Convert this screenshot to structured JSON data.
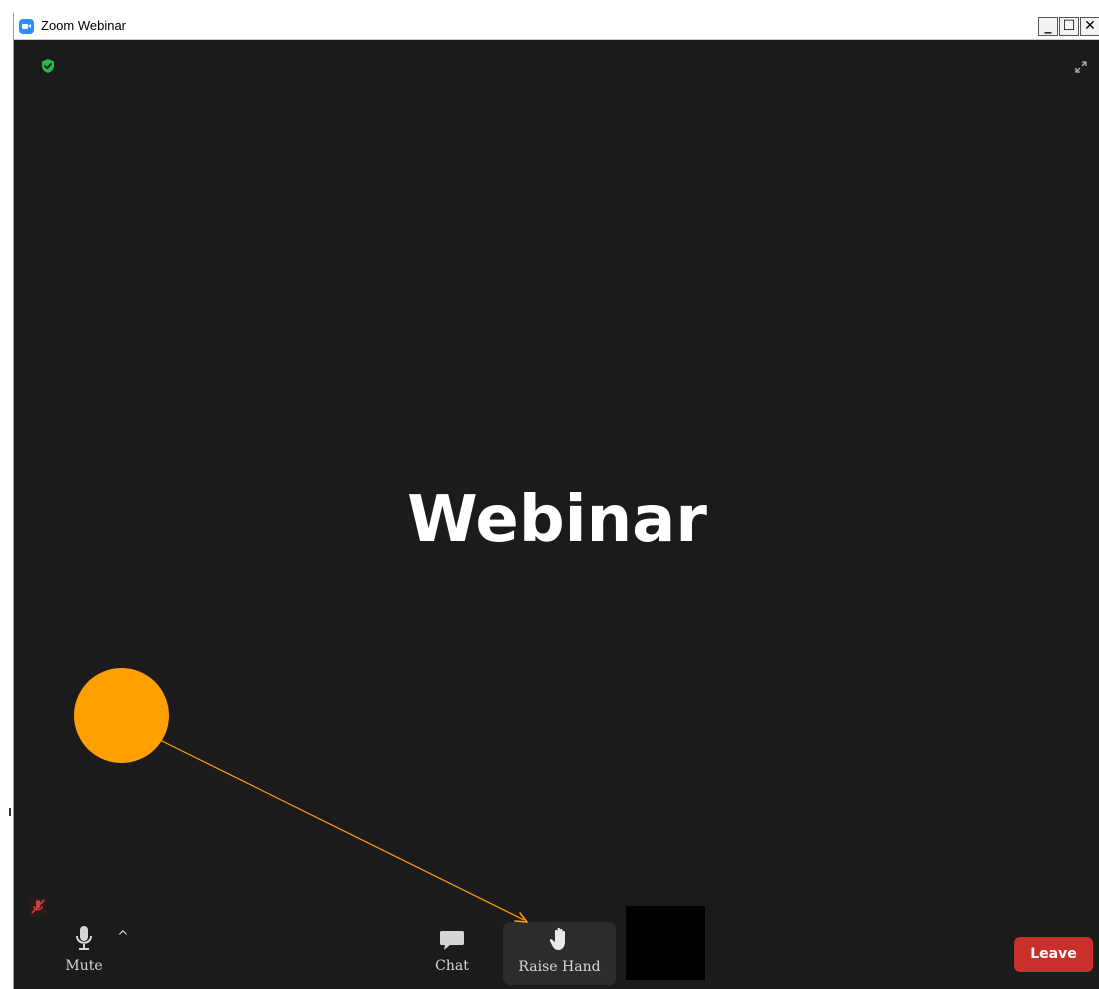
{
  "window": {
    "title": "Zoom Webinar",
    "controls": {
      "minimize": "_",
      "maximize": "☐",
      "close": "✕"
    }
  },
  "main": {
    "title": "Webinar"
  },
  "toolbar": {
    "mute_label": "Mute",
    "mute_caret": "^",
    "chat_label": "Chat",
    "raise_hand_label": "Raise Hand",
    "leave_label": "Leave"
  },
  "icons": {
    "security": "shield-check-icon",
    "expand": "expand-icon",
    "muted_badge": "mic-off-icon",
    "mute": "microphone-icon",
    "chat": "chat-bubble-icon",
    "raise_hand": "hand-icon"
  },
  "colors": {
    "background": "#1b1b1b",
    "leave": "#c9302c",
    "shield": "#25b84a",
    "annotation": "#ff9f00"
  }
}
